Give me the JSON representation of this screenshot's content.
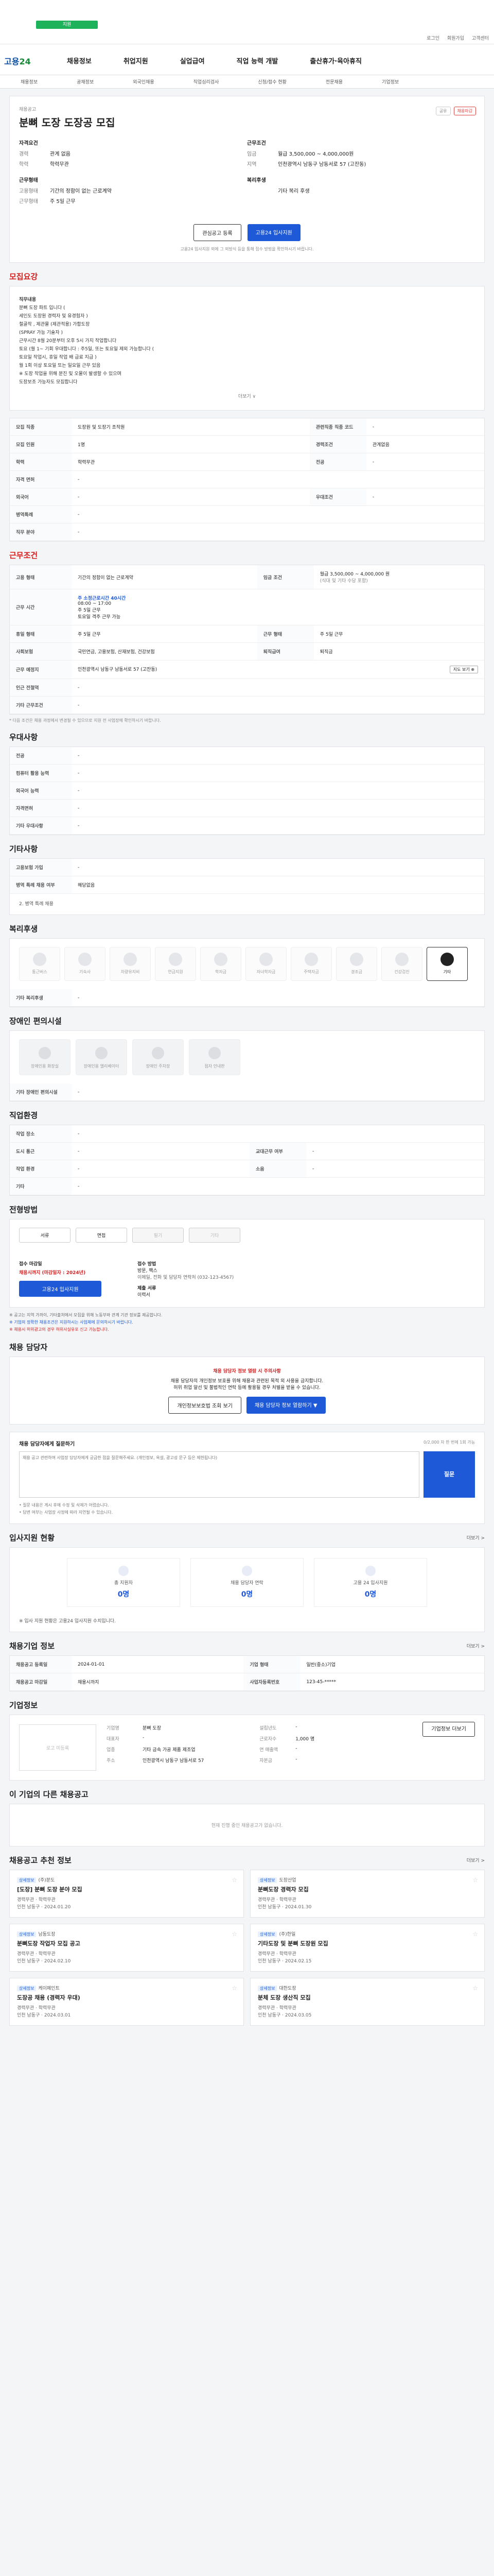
{
  "top": {
    "greenpill": "지원",
    "util_links": [
      "로그인",
      "회원가입",
      "고객센터"
    ]
  },
  "gnb": {
    "brand_a": "고용",
    "brand_b": "24",
    "menu": [
      "채용정보",
      "취업지원",
      "실업급여",
      "직업 능력 개발",
      "출산휴가·육아휴직"
    ]
  },
  "subnav": [
    "채용정보",
    "공채정보",
    "외국인채용",
    "직업심리검사",
    "신청/접수 현황",
    "전문채용",
    "기업정보"
  ],
  "hero": {
    "label": "채용공고",
    "title": "분뼈 도장 도장공 모집",
    "share": [
      "공유",
      "채용마감"
    ],
    "left": {
      "g1_title": "자격요건",
      "g1_rows": [
        [
          "경력",
          "관계 없음"
        ],
        [
          "학력",
          "학력무관"
        ]
      ],
      "g2_title": "근무형태",
      "g2_rows": [
        [
          "고용형태",
          "기간의 정함이 없는 근로계약"
        ],
        [
          "근무형태",
          "주 5일 근무"
        ]
      ]
    },
    "right": {
      "g1_title": "근무조건",
      "g1_rows": [
        [
          "임금",
          "월급 3,500,000 ~ 4,000,000원"
        ],
        [
          "지역",
          "인천광역시 남동구 남동서로 57 (고잔동)"
        ]
      ],
      "g2_title": "복리후생",
      "g2_rows": [
        [
          "",
          "기타 복리 후생"
        ]
      ]
    },
    "btn_save": "관심공고 등록",
    "btn_apply": "고용24 입사지원",
    "note": "고용24 입사지원 외에 그 외방식 등을 통해 접수 방법을 확인하시기 바랍니다."
  },
  "sec1": {
    "title": "모집요강"
  },
  "desc": {
    "lines": [
      "직무내용",
      "분뼈 도장 파트 입니다 (",
      "세인도 도장원 경력자 및 유경험자 )",
      "철골작 , 제관물 (제관적용) 가합도장",
      "(SPRAY 가능 기술자 )",
      "근무시간 8월 20분부터 오후 5시 가지 작업합니다",
      "토요 (월 1~ 기회 우대합니다 : 주5일, 또는 토요일 제외 가능합니다 (",
      "토요일 작업시, 휴일 작업 배 급료 지급 )",
      "월 1회 이상 토요일 또는 일요일 근무 있음 ",
      "※ 도장 작업을 위해 분진 및 오물이 발생할 수 있으며 ",
      "도장보조 가능자도 모집합니다 "
    ],
    "fold": "더보기 ∨"
  },
  "info1": [
    [
      [
        "모집 직종",
        "도장원 및 도장기 조작원"
      ],
      [
        "관련직종 직종 코드",
        "-"
      ]
    ],
    [
      [
        "모집 인원",
        "1명"
      ],
      [
        "경력조건",
        "관계없음"
      ]
    ],
    [
      [
        "학력",
        "학력무관"
      ],
      [
        "전공",
        "-"
      ]
    ],
    [
      [
        "자격 면허",
        "-"
      ],
      [
        "",
        ""
      ]
    ],
    [
      [
        "외국어",
        "-"
      ],
      [
        "우대조건",
        "-"
      ]
    ],
    [
      [
        "병역특례",
        "-"
      ],
      [
        "",
        ""
      ]
    ],
    [
      [
        "직무 분야",
        "-"
      ],
      [
        "",
        ""
      ]
    ]
  ],
  "sec2": {
    "title": "근무조건"
  },
  "cond": {
    "emp_type": "기간의 정함이 없는 근로계약",
    "wage_label": "임금 조건",
    "wage": "월급 3,500,000 ~ 4,000,000 원",
    "wage_note": "(식대 및 기타 수당 포함)",
    "work_label": "근무 시간",
    "work_tag": "주 소정근로시간 40시간",
    "work_lines": [
      "08:00 ~ 17:00",
      "주 5일 근무",
      "토요일 격주 근무 가능"
    ],
    "holiday": "주 5일 근무",
    "region": "인천광역시 남동구 남동서로 57 (고잔동)",
    "insurance": "국민연금, 고용보험, 산재보험, 건강보험",
    "pension": "퇴직금",
    "retire_label": "퇴직급여",
    "near_station": "-",
    "map_btn": "지도 보기 ⊕",
    "inst_label": "근무 예정지",
    "etc": "-"
  },
  "cond_foot": "* 다음 조건은 채용 과정에서 변경될 수 있으므로 지원 전 사업장에 확인하시기 바랍니다.",
  "sec3": {
    "title": "우대사항"
  },
  "prefer": [
    [
      "전공",
      "-"
    ],
    [
      "컴퓨터 활용 능력",
      "-"
    ],
    [
      "외국어 능력",
      "-"
    ],
    [
      "자격면허",
      "-"
    ],
    [
      "기타 우대사항",
      "-"
    ]
  ],
  "sec4": {
    "title": "기타사항"
  },
  "etc": [
    [
      "고용보험 가입",
      "-"
    ],
    [
      "병역 특례 채용 여부",
      "해당없음"
    ]
  ],
  "etc_note": "2. 병역 특례 채용",
  "sec5": {
    "title": "복리후생"
  },
  "welfare": [
    {
      "l": "통근버스",
      "on": false
    },
    {
      "l": "기숙사",
      "on": false
    },
    {
      "l": "차량유지비",
      "on": false
    },
    {
      "l": "연금지원",
      "on": false
    },
    {
      "l": "학자금",
      "on": false
    },
    {
      "l": "자녀학자금",
      "on": false
    },
    {
      "l": "주택자금",
      "on": false
    },
    {
      "l": "경조금",
      "on": false
    },
    {
      "l": "건강검진",
      "on": false
    },
    {
      "l": "기타",
      "on": true
    }
  ],
  "welfare_extra": "기타 복리후생",
  "sec6": {
    "title": "장애인 편의시설"
  },
  "facility": [
    "장애인용 화장실",
    "장애인용 엘리베이터",
    "장애인 주차장",
    "점자 안내판"
  ],
  "facility_extra": "기타 장애인 편의시설",
  "sec7": {
    "title": "직업환경"
  },
  "envi": [
    [
      [
        "작업 장소",
        "-"
      ],
      [
        "",
        ""
      ]
    ],
    [
      [
        "도시 통근",
        "-"
      ],
      [
        "교대근무 여부",
        "-"
      ]
    ],
    [
      [
        "작업 환경",
        "-"
      ],
      [
        "소음",
        "-"
      ]
    ],
    [
      [
        "기타",
        "-"
      ],
      [
        "",
        ""
      ]
    ]
  ],
  "sec8": {
    "title": "전형방법"
  },
  "screen": [
    "서류",
    "면접",
    "필기",
    "기타"
  ],
  "apply": {
    "deadline_t": "접수 마감일",
    "deadline": "채용시까지 (마감일자 : 2024년)",
    "method_t": "접수 방법",
    "method": "방문, 팩스 ",
    "contact": "이메일, 전화 및 담당자 연락처 (032-123-4567)",
    "docs_t": "제출 서류",
    "docs": "이력서",
    "btn": "고용24 입사지원"
  },
  "apply_notes": [
    "※ 공고는 지역 가까이, 기타출처에서 모집을 위해 노동부와 관계 기관 정보를 제공합니다.",
    "※ 기업의 정확한 채용조건은 지원하시는 사업체에 문의하시기 바랍니다.",
    "※ 채용시 허위광고의 경우 허위사실유포 신고 가능합니다."
  ],
  "sec9": {
    "title": "채용 담당자"
  },
  "warn": {
    "t": "채용 담당자 정보 열람 시 주의사항",
    "d1": "채용 담당자의 개인정보 보호를 위해 채용과 관련된 목적 외 사용을 금지합니다.",
    "d2": "허위 취업 알선 및 불법적인 연락 등에 활용될 경우 처벌을 받을 수 있습니다.",
    "b1": "개인정보보호법 조회 보기",
    "b2": "채용 담당자 정보 열람하기 ▼"
  },
  "q": {
    "title": "채용 담당자에게 질문하기",
    "cnt": "0/2,000 자 한 번에 1회 가능",
    "placeholder": "채용 공고 관련하여 사업장 담당자에게 궁금한 점을 질문해주세요. (개인정보, 욕설, 광고성 문구 등은 제한됩니다)",
    "go": "질문",
    "n1": "• 질문 내용은 게시 후에 수정 및 삭제가 어렵습니다.",
    "n2": "• 답변 여부는 사업장 사정에 따라 지연될 수 있습니다."
  },
  "sec10": {
    "title": "입사지원 현황",
    "more": "더보기 >"
  },
  "stats": [
    [
      "총 지원자",
      "0명"
    ],
    [
      "채용 담당자 연락",
      "0명"
    ],
    [
      "고용 24 입사지원",
      "0명"
    ]
  ],
  "stats_note": "※ 입사 지원 현황은 고용24 입사지원 수치입니다.",
  "sec11": {
    "title": "채용기업 정보",
    "more": "더보기 >"
  },
  "corp_info": [
    [
      [
        "채용공고 등록일",
        "2024-01-01"
      ],
      [
        "기업 형태",
        "일반(중소)기업"
      ]
    ],
    [
      [
        "채용공고 마감일",
        "채용시까지"
      ],
      [
        "사업자등록번호",
        "123-45-*****"
      ]
    ]
  ],
  "sec12": {
    "title": "기업정보"
  },
  "co": {
    "logo": "로고 미등록",
    "rows_l": [
      [
        "기업명",
        "분뼈 도장"
      ],
      [
        "대표자",
        "-"
      ],
      [
        "업종",
        "기타 금속 가공 제품 제조업"
      ],
      [
        "주소",
        "인천광역시 남동구 남동서로 57"
      ]
    ],
    "rows_r": [
      [
        "설립년도",
        "-"
      ],
      [
        "근로자수",
        "1,000 명"
      ],
      [
        "연 매출액",
        "-"
      ],
      [
        "자본금",
        "-"
      ]
    ],
    "btn": "기업정보 더보기"
  },
  "sec13": {
    "title": "이 기업의 다른 채용공고"
  },
  "empty": "현재 진행 중인 채용공고가 없습니다.",
  "sec14": {
    "title": "채용공고 추천 정보",
    "more": "더보기 >"
  },
  "recs": [
    {
      "co": "(주)분도",
      "tag": "상세정보",
      "t": "[도장] 분뼈 도장 분야 모집",
      "m1": "경력무관 · 학력무관",
      "m2": "인천 남동구 · 2024.01.20"
    },
    {
      "co": "도장산업",
      "tag": "상세정보",
      "t": "분뼈도장 경력자 모집",
      "m1": "경력무관 · 학력무관",
      "m2": "인천 남동구 · 2024.01.30"
    },
    {
      "co": "남동도장",
      "tag": "상세정보",
      "t": "분뼈도장 작업자 모집 공고",
      "m1": "경력무관 · 학력무관",
      "m2": "인천 남동구 · 2024.02.10"
    },
    {
      "co": "(주)한일",
      "tag": "상세정보",
      "t": "기타도장 및 분뼈 도장원 모집",
      "m1": "경력무관 · 학력무관",
      "m2": "인천 남동구 · 2024.02.15"
    },
    {
      "co": "케이페인트",
      "tag": "상세정보",
      "t": "도장공 채용 (경력자 우대)",
      "m1": "경력무관 · 학력무관",
      "m2": "인천 남동구 · 2024.03.01"
    },
    {
      "co": "대한도장",
      "tag": "상세정보",
      "t": "분체 도장 생산직 모집",
      "m1": "경력무관 · 학력무관",
      "m2": "인천 남동구 · 2024.03.05"
    }
  ]
}
